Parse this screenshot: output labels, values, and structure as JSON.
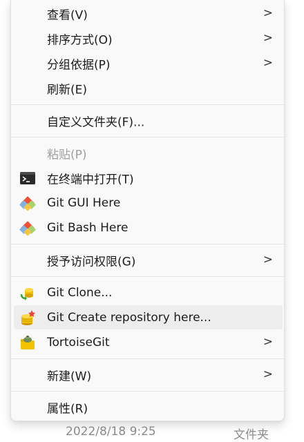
{
  "menu": {
    "view": {
      "label": "查看(V)",
      "chevron": ">"
    },
    "sort": {
      "label": "排序方式(O)",
      "chevron": ">"
    },
    "group": {
      "label": "分组依据(P)",
      "chevron": ">"
    },
    "refresh": {
      "label": "刷新(E)"
    },
    "customize": {
      "label": "自定义文件夹(F)..."
    },
    "paste": {
      "label": "粘贴(P)",
      "disabled": true
    },
    "terminal": {
      "label": "在终端中打开(T)",
      "icon": "terminal-icon"
    },
    "git_gui": {
      "label": "Git GUI Here",
      "icon": "git-icon"
    },
    "git_bash": {
      "label": "Git Bash Here",
      "icon": "git-icon"
    },
    "grant": {
      "label": "授予访问权限(G)",
      "chevron": ">"
    },
    "git_clone": {
      "label": "Git Clone...",
      "icon": "tortoisegit-clone-icon"
    },
    "git_create": {
      "label": "Git Create repository here...",
      "icon": "tortoisegit-create-repo-icon",
      "hovered": true
    },
    "tortoisegit": {
      "label": "TortoiseGit",
      "chevron": ">",
      "icon": "tortoisegit-icon"
    },
    "new": {
      "label": "新建(W)",
      "chevron": ">"
    },
    "properties": {
      "label": "属性(R)"
    }
  },
  "footer": {
    "date": "2022/8/18 9:25",
    "type": "文件夹"
  },
  "colors": {
    "menu_bg": "#f9f9f9",
    "hover_bg": "#ededed",
    "text": "#1b1b1b",
    "disabled_text": "#a0a0a0",
    "git_orange": "#f05133"
  }
}
